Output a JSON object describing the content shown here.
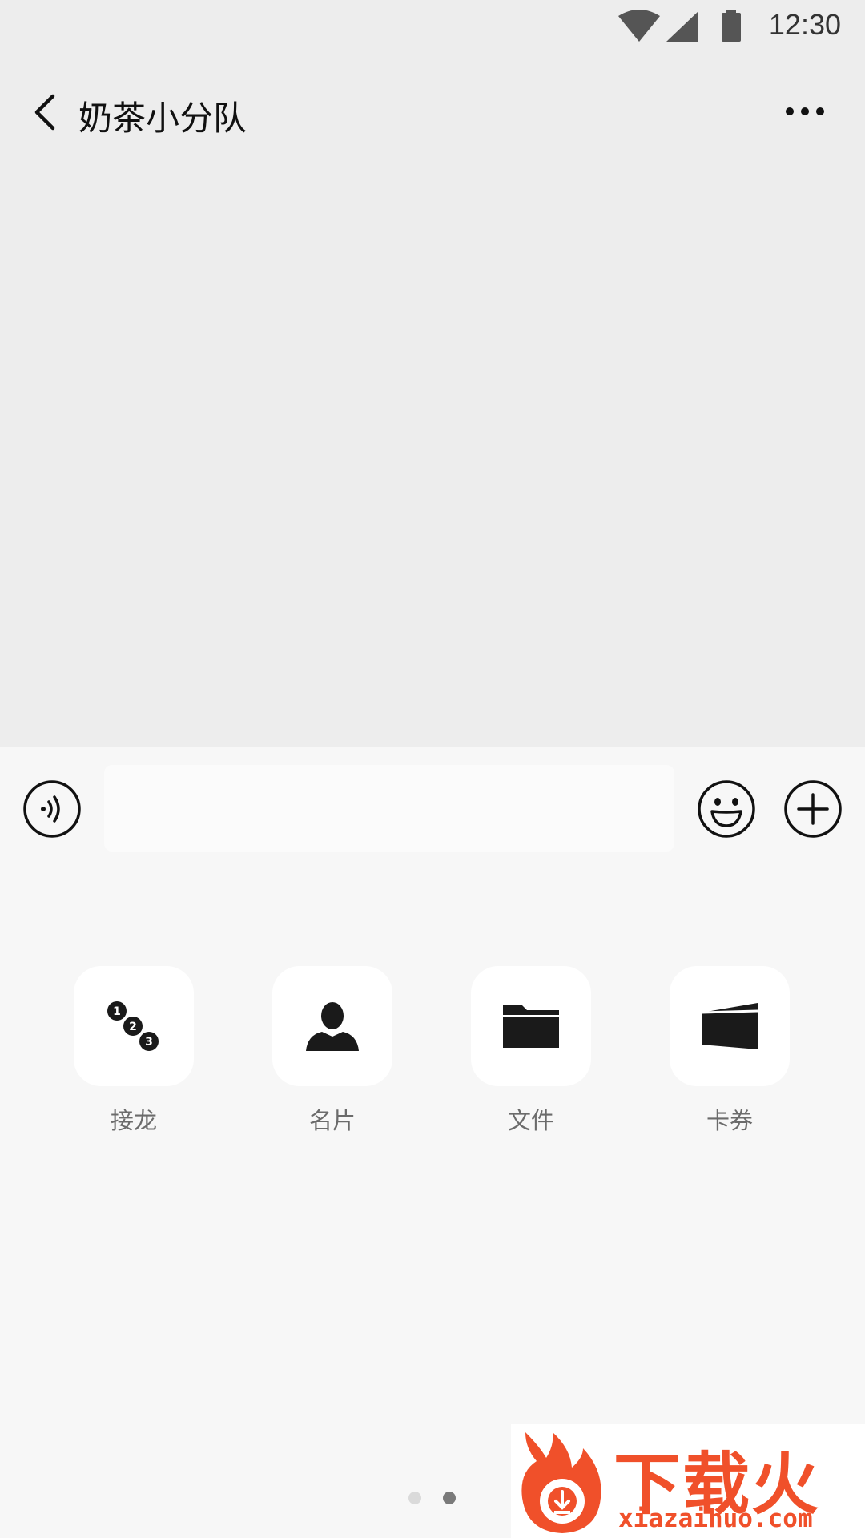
{
  "status_bar": {
    "time": "12:30"
  },
  "header": {
    "title": "奶茶小分队"
  },
  "input_bar": {
    "text_value": "",
    "placeholder": ""
  },
  "tools": [
    {
      "label": "接龙",
      "icon": "solitaire-123-icon"
    },
    {
      "label": "名片",
      "icon": "contact-card-icon"
    },
    {
      "label": "文件",
      "icon": "folder-icon"
    },
    {
      "label": "卡券",
      "icon": "card-wallet-icon"
    }
  ],
  "pager": {
    "pages": 2,
    "current": 2
  },
  "watermark": {
    "cn": "下载火",
    "en": "xiazaihuo.com"
  },
  "colors": {
    "background": "#ededed",
    "panel": "#f7f7f7",
    "tile": "#ffffff",
    "icon": "#1a1a1a",
    "label": "#6b6b6b",
    "watermark": "#f0502a"
  }
}
